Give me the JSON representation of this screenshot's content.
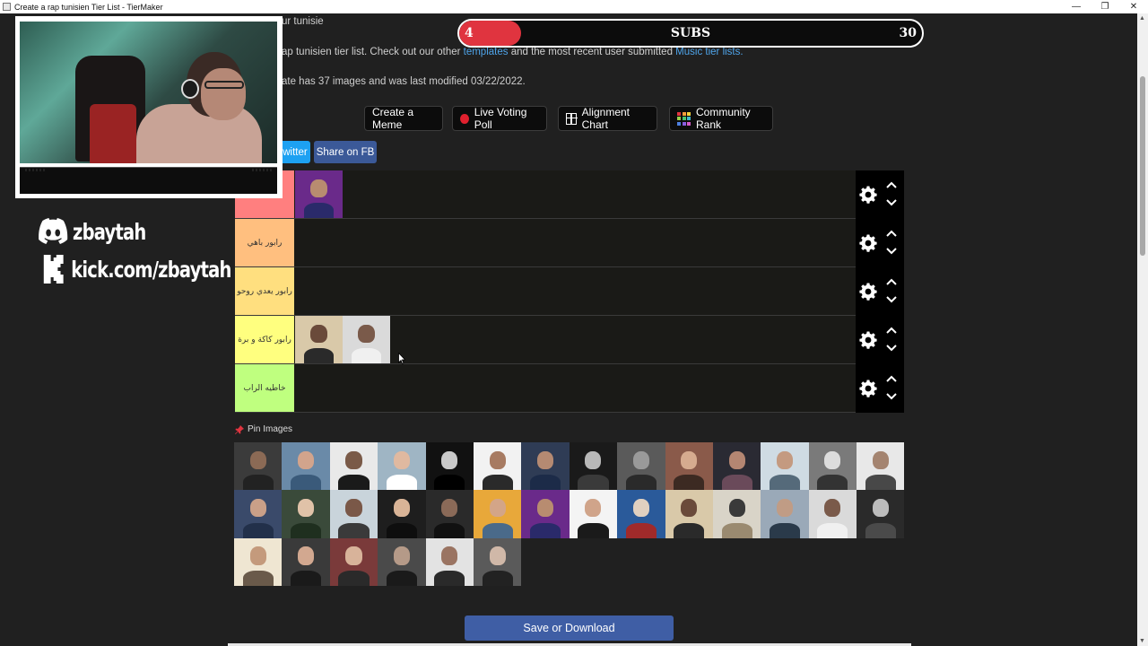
{
  "window": {
    "title": "Create a rap tunisien Tier List - TierMaker",
    "controls": {
      "minimize": "—",
      "restore": "❐",
      "close": "✕"
    }
  },
  "intro": {
    "line1": "ur tunisie",
    "line2_prefix": "ap tunisien tier list. Check out our other",
    "line2_link1": "templates",
    "line2_mid": "and the most recent user submitted",
    "line2_link2": "Music tier lists.",
    "line3": "ate has 37 images and was last modified 03/22/2022."
  },
  "subs_goal": {
    "current": "4",
    "label": "SUBS",
    "goal": "30",
    "progress_fraction": 0.133
  },
  "actions": {
    "create_meme": "Create a Meme",
    "live_voting_poll": "Live Voting Poll",
    "alignment_chart": "Alignment Chart",
    "community_rank": "Community Rank"
  },
  "share": {
    "twitter": "witter",
    "facebook": "Share on FB"
  },
  "tiers": [
    {
      "label": "",
      "color": "#ff7f7f",
      "item_count": 1
    },
    {
      "label": "رابور باهي",
      "color": "#ffbf7f",
      "item_count": 0
    },
    {
      "label": "رابور يعدي روحو",
      "color": "#ffdf7f",
      "item_count": 0
    },
    {
      "label": "رابور كاكة و برة",
      "color": "#ffff7f",
      "item_count": 2
    },
    {
      "label": "خاطيه الراب",
      "color": "#bfff7f",
      "item_count": 0
    }
  ],
  "pin_images": {
    "label": "Pin Images",
    "count": 34
  },
  "save": {
    "label": "Save or Download"
  },
  "overlay": {
    "discord_handle": "zbaytah",
    "kick_url": "kick.com/zbaytah"
  },
  "colors": {
    "tier_row_bg": "#1a1a17",
    "controls_bg": "#000000",
    "accent_red": "#e0343f",
    "link_blue": "#4ea3e8",
    "save_blue": "#3f5ea5",
    "twitter_blue": "#1da1f2",
    "fb_blue": "#3b5998"
  }
}
